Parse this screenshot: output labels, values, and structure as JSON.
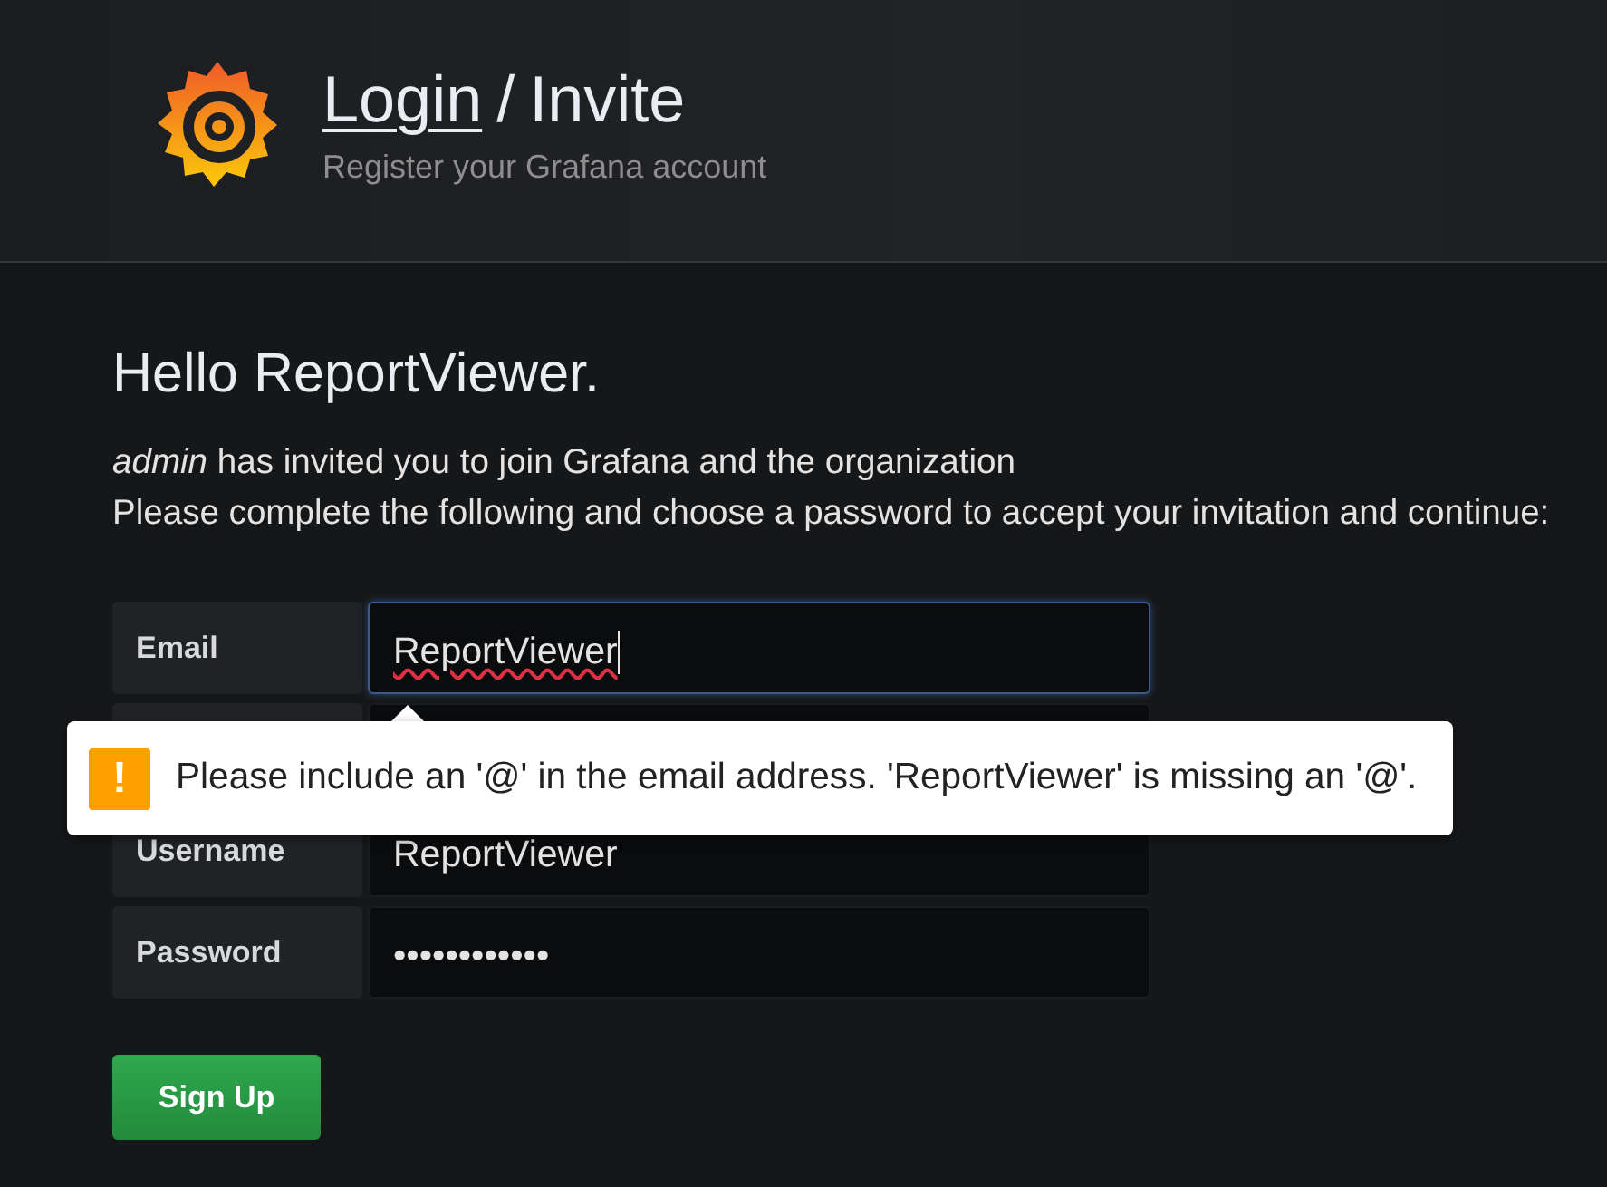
{
  "header": {
    "title_link": "Login",
    "title_separator": "/",
    "title_rest": "Invite",
    "subtitle": "Register your Grafana account"
  },
  "greeting": "Hello ReportViewer.",
  "invitation": {
    "inviter": "admin",
    "line_1": "has invited you to join Grafana and the organization",
    "line_2": "Please complete the following and choose a password to accept your invitation and continue:"
  },
  "fields": [
    {
      "kind": "text",
      "label": "Email",
      "value": "ReportViewer",
      "focused": true,
      "spell_error": true
    },
    {
      "kind": "covered"
    },
    {
      "kind": "text",
      "label": "Username",
      "value": "ReportViewer",
      "focused": false,
      "spell_error": false
    },
    {
      "kind": "password",
      "label": "Password",
      "value": "••••••••••••",
      "focused": false,
      "spell_error": false
    }
  ],
  "validation_tooltip": {
    "icon": "!",
    "message": "Please include an '@' in the email address. 'ReportViewer' is missing an '@'."
  },
  "submit_button": "Sign Up"
}
